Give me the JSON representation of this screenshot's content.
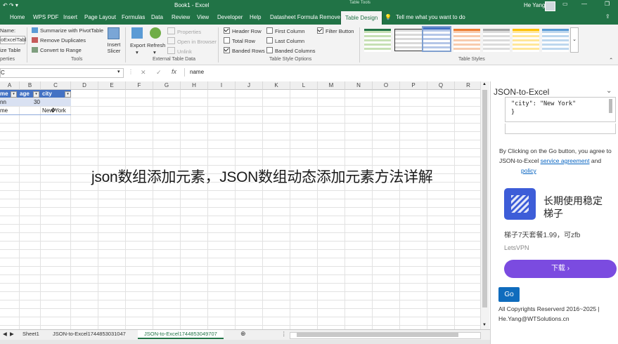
{
  "window": {
    "title": "Book1 - Excel",
    "table_tools": "Table Tools",
    "user": "He Yang"
  },
  "tabs": [
    "Home",
    "WPS PDF",
    "Insert",
    "Page Layout",
    "Formulas",
    "Data",
    "Review",
    "View",
    "Developer",
    "Help",
    "Datasheet Formula Remover",
    "Table Design"
  ],
  "tell_me": "Tell me what you want to do",
  "ribbon": {
    "properties": {
      "name_label": "Name:",
      "name_value": "oExcelTabl",
      "resize": "ize Table",
      "group": "perties"
    },
    "tools": {
      "items": [
        "Summarize with PivotTable",
        "Remove Duplicates",
        "Convert to Range"
      ],
      "slicer": "Insert Slicer",
      "group": "Tools"
    },
    "external": {
      "export": "Export",
      "refresh": "Refresh",
      "properties": "Properties",
      "open_browser": "Open in Browser",
      "unlink": "Unlink",
      "group": "External Table Data"
    },
    "style_options": {
      "col1": [
        {
          "label": "Header Row",
          "checked": true
        },
        {
          "label": "Total Row",
          "checked": false
        },
        {
          "label": "Banded Rows",
          "checked": true
        }
      ],
      "col2": [
        {
          "label": "First Column",
          "checked": false
        },
        {
          "label": "Last Column",
          "checked": false
        },
        {
          "label": "Banded Columns",
          "checked": false
        }
      ],
      "col3": [
        {
          "label": "Filter Button",
          "checked": true
        }
      ],
      "group": "Table Style Options"
    },
    "styles_group": "Table Styles",
    "colors": {
      "green": "#217346",
      "dark": "#333333",
      "blue": "#4472c4",
      "orange": "#ed7d31",
      "gray": "#a5a5a5",
      "gold": "#ffc000",
      "lightblue": "#5b9bd5"
    }
  },
  "formula_bar": {
    "namebox": "C",
    "fx": "fx",
    "content": "name"
  },
  "grid": {
    "columns": [
      "A",
      "B",
      "C",
      "D",
      "E",
      "F",
      "G",
      "H",
      "I",
      "J",
      "K",
      "L",
      "M",
      "N",
      "O",
      "P",
      "Q",
      "R"
    ],
    "header_row": [
      "me",
      "age",
      "city"
    ],
    "rows": [
      [
        "nn",
        "30",
        ""
      ],
      [
        "me",
        "",
        "New York"
      ]
    ]
  },
  "sheet_tabs": [
    "Sheet1",
    "JSON-to-Excel1744853031047",
    "JSON-to-Excel1744853049707"
  ],
  "pane": {
    "title": "JSON-to-Excel",
    "code_line1": "\"city\": \"New York\"",
    "code_line2": "}",
    "notice_prefix": "By Clicking on the Go button, you agree to",
    "notice_mid": "JSON-to-Excel",
    "link_agreement": "service agreement",
    "and": "and",
    "link_policy": "policy",
    "ad_title_line1": "长期使用稳定",
    "ad_title_line2": "梯子",
    "ad_desc": "梯子7天套餐1.99，可zfb",
    "ad_brand": "LetsVPN",
    "ad_button": "下载",
    "go": "Go",
    "copyright": "All Copyrights Reserverd 2016~2025 |",
    "email": "He.Yang@WTSolutions.cn"
  },
  "banner": "json数组添加元素，JSON数组动态添加元素方法详解"
}
